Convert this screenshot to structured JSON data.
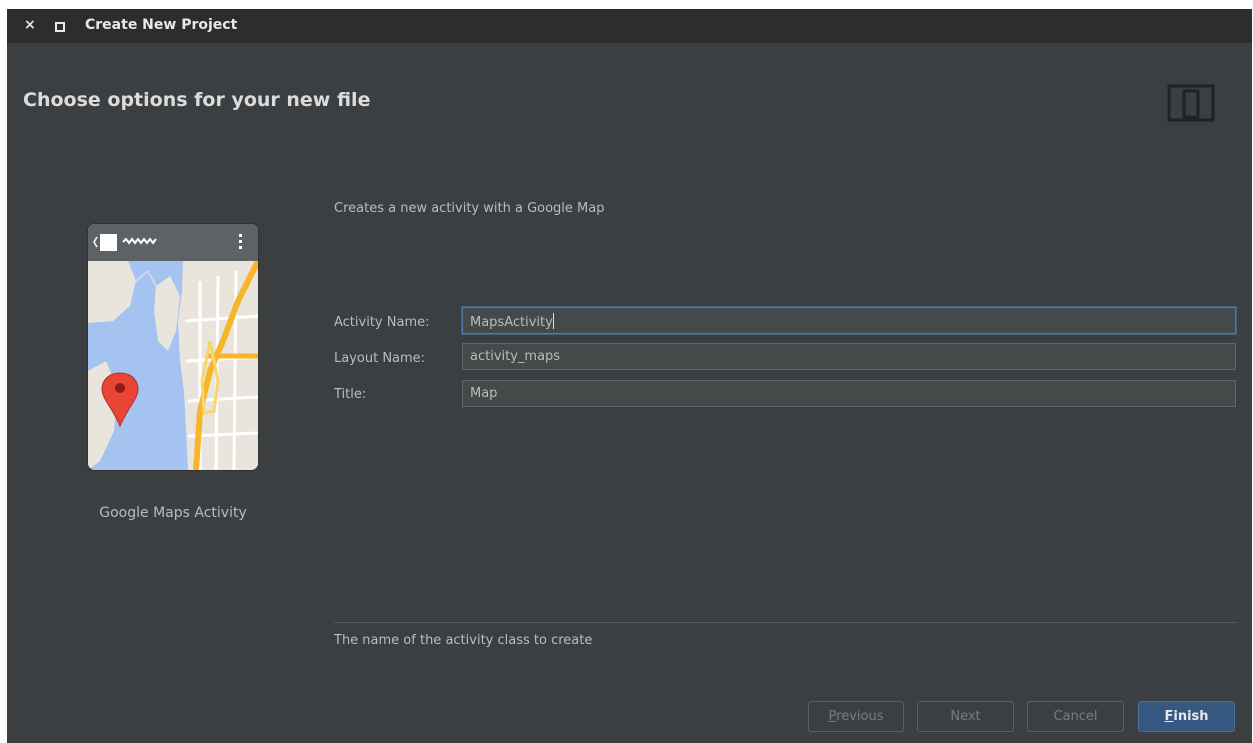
{
  "window": {
    "title": "Create New Project",
    "close_glyph": "×"
  },
  "header": {
    "title": "Choose options for your new file",
    "icon": "device-phone-tablet-icon"
  },
  "template": {
    "name": "Google Maps Activity",
    "preview_icon": "map-preview-icon"
  },
  "description": "Creates a new activity with a Google Map",
  "form": {
    "activity_name": {
      "label": "Activity Name:",
      "value": "MapsActivity"
    },
    "layout_name": {
      "label": "Layout Name:",
      "value": "activity_maps"
    },
    "title": {
      "label": "Title:",
      "value": "Map"
    }
  },
  "hint": "The name of the activity class to create",
  "buttons": {
    "previous": {
      "mnemonic": "P",
      "rest": "revious"
    },
    "next": {
      "label": "Next"
    },
    "cancel": {
      "label": "Cancel"
    },
    "finish": {
      "mnemonic": "F",
      "rest": "inish"
    }
  },
  "colors": {
    "dialog_bg": "#3c3f41",
    "titlebar_bg": "#2d2d2d",
    "primary_button": "#365880",
    "map_water": "#a4c3f0",
    "map_road": "#f7b52b",
    "map_pin": "#e84537"
  }
}
